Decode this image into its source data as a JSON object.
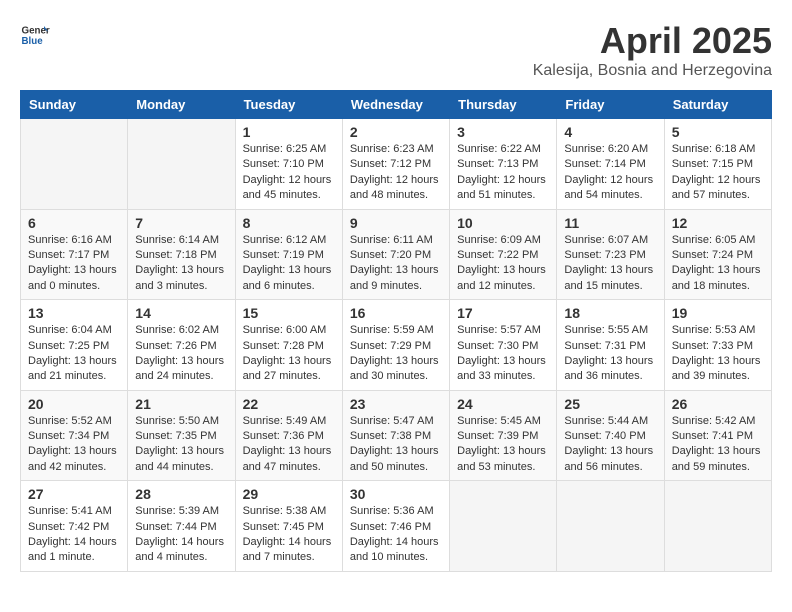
{
  "header": {
    "logo_general": "General",
    "logo_blue": "Blue",
    "month_title": "April 2025",
    "location": "Kalesija, Bosnia and Herzegovina"
  },
  "weekdays": [
    "Sunday",
    "Monday",
    "Tuesday",
    "Wednesday",
    "Thursday",
    "Friday",
    "Saturday"
  ],
  "weeks": [
    [
      {
        "day": "",
        "info": ""
      },
      {
        "day": "",
        "info": ""
      },
      {
        "day": "1",
        "info": "Sunrise: 6:25 AM\nSunset: 7:10 PM\nDaylight: 12 hours and 45 minutes."
      },
      {
        "day": "2",
        "info": "Sunrise: 6:23 AM\nSunset: 7:12 PM\nDaylight: 12 hours and 48 minutes."
      },
      {
        "day": "3",
        "info": "Sunrise: 6:22 AM\nSunset: 7:13 PM\nDaylight: 12 hours and 51 minutes."
      },
      {
        "day": "4",
        "info": "Sunrise: 6:20 AM\nSunset: 7:14 PM\nDaylight: 12 hours and 54 minutes."
      },
      {
        "day": "5",
        "info": "Sunrise: 6:18 AM\nSunset: 7:15 PM\nDaylight: 12 hours and 57 minutes."
      }
    ],
    [
      {
        "day": "6",
        "info": "Sunrise: 6:16 AM\nSunset: 7:17 PM\nDaylight: 13 hours and 0 minutes."
      },
      {
        "day": "7",
        "info": "Sunrise: 6:14 AM\nSunset: 7:18 PM\nDaylight: 13 hours and 3 minutes."
      },
      {
        "day": "8",
        "info": "Sunrise: 6:12 AM\nSunset: 7:19 PM\nDaylight: 13 hours and 6 minutes."
      },
      {
        "day": "9",
        "info": "Sunrise: 6:11 AM\nSunset: 7:20 PM\nDaylight: 13 hours and 9 minutes."
      },
      {
        "day": "10",
        "info": "Sunrise: 6:09 AM\nSunset: 7:22 PM\nDaylight: 13 hours and 12 minutes."
      },
      {
        "day": "11",
        "info": "Sunrise: 6:07 AM\nSunset: 7:23 PM\nDaylight: 13 hours and 15 minutes."
      },
      {
        "day": "12",
        "info": "Sunrise: 6:05 AM\nSunset: 7:24 PM\nDaylight: 13 hours and 18 minutes."
      }
    ],
    [
      {
        "day": "13",
        "info": "Sunrise: 6:04 AM\nSunset: 7:25 PM\nDaylight: 13 hours and 21 minutes."
      },
      {
        "day": "14",
        "info": "Sunrise: 6:02 AM\nSunset: 7:26 PM\nDaylight: 13 hours and 24 minutes."
      },
      {
        "day": "15",
        "info": "Sunrise: 6:00 AM\nSunset: 7:28 PM\nDaylight: 13 hours and 27 minutes."
      },
      {
        "day": "16",
        "info": "Sunrise: 5:59 AM\nSunset: 7:29 PM\nDaylight: 13 hours and 30 minutes."
      },
      {
        "day": "17",
        "info": "Sunrise: 5:57 AM\nSunset: 7:30 PM\nDaylight: 13 hours and 33 minutes."
      },
      {
        "day": "18",
        "info": "Sunrise: 5:55 AM\nSunset: 7:31 PM\nDaylight: 13 hours and 36 minutes."
      },
      {
        "day": "19",
        "info": "Sunrise: 5:53 AM\nSunset: 7:33 PM\nDaylight: 13 hours and 39 minutes."
      }
    ],
    [
      {
        "day": "20",
        "info": "Sunrise: 5:52 AM\nSunset: 7:34 PM\nDaylight: 13 hours and 42 minutes."
      },
      {
        "day": "21",
        "info": "Sunrise: 5:50 AM\nSunset: 7:35 PM\nDaylight: 13 hours and 44 minutes."
      },
      {
        "day": "22",
        "info": "Sunrise: 5:49 AM\nSunset: 7:36 PM\nDaylight: 13 hours and 47 minutes."
      },
      {
        "day": "23",
        "info": "Sunrise: 5:47 AM\nSunset: 7:38 PM\nDaylight: 13 hours and 50 minutes."
      },
      {
        "day": "24",
        "info": "Sunrise: 5:45 AM\nSunset: 7:39 PM\nDaylight: 13 hours and 53 minutes."
      },
      {
        "day": "25",
        "info": "Sunrise: 5:44 AM\nSunset: 7:40 PM\nDaylight: 13 hours and 56 minutes."
      },
      {
        "day": "26",
        "info": "Sunrise: 5:42 AM\nSunset: 7:41 PM\nDaylight: 13 hours and 59 minutes."
      }
    ],
    [
      {
        "day": "27",
        "info": "Sunrise: 5:41 AM\nSunset: 7:42 PM\nDaylight: 14 hours and 1 minute."
      },
      {
        "day": "28",
        "info": "Sunrise: 5:39 AM\nSunset: 7:44 PM\nDaylight: 14 hours and 4 minutes."
      },
      {
        "day": "29",
        "info": "Sunrise: 5:38 AM\nSunset: 7:45 PM\nDaylight: 14 hours and 7 minutes."
      },
      {
        "day": "30",
        "info": "Sunrise: 5:36 AM\nSunset: 7:46 PM\nDaylight: 14 hours and 10 minutes."
      },
      {
        "day": "",
        "info": ""
      },
      {
        "day": "",
        "info": ""
      },
      {
        "day": "",
        "info": ""
      }
    ]
  ]
}
